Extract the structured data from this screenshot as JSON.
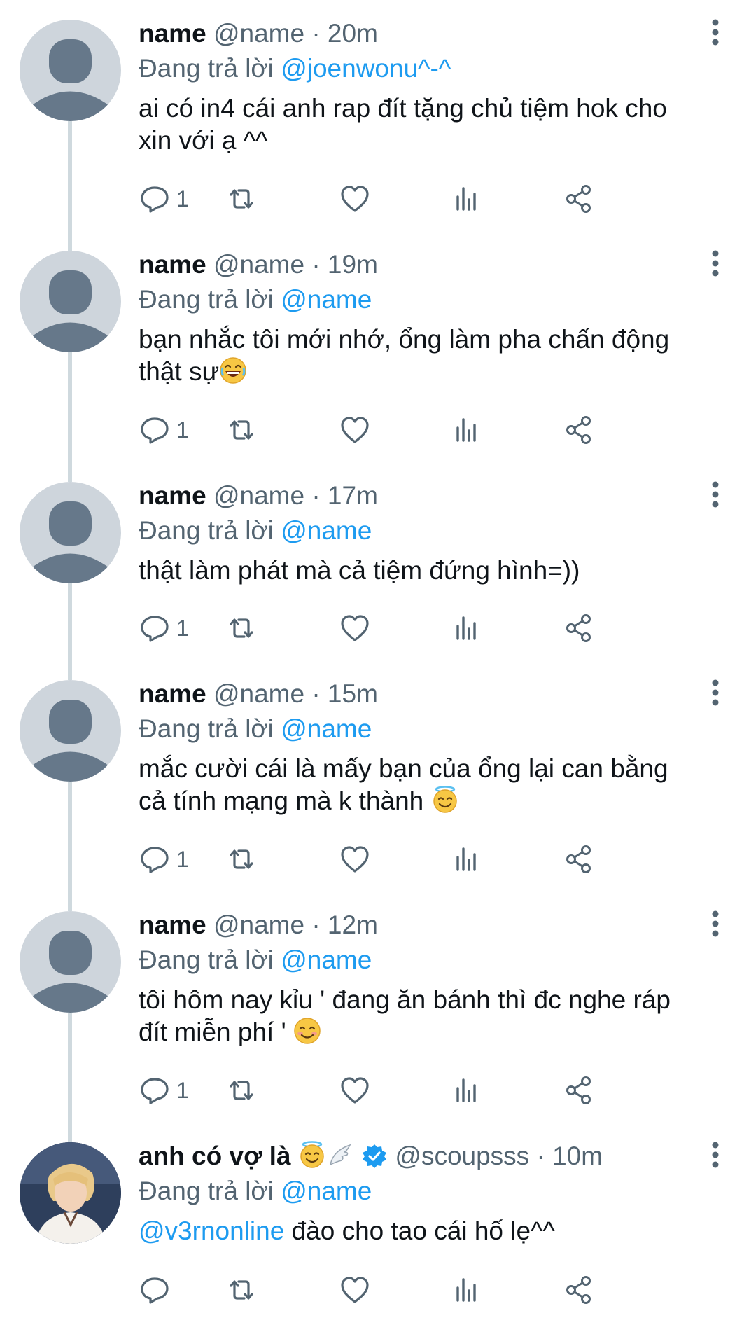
{
  "replying_label": "Đang trả lời",
  "tweets": [
    {
      "display_name": "name",
      "meta": "@name · 20m",
      "reply_to": "@joenwonu^-^",
      "text_prefix": "",
      "text": "ai có in4 cái anh rap đít tặng chủ tiệm hok cho xin với ạ ^^",
      "reply_count": "1",
      "emoji": ""
    },
    {
      "display_name": "name",
      "meta": "@name · 19m",
      "reply_to": "@name",
      "text_prefix": "",
      "text": "bạn nhắc tôi mới nhớ, ổng làm pha chấn động thật sự",
      "reply_count": "1",
      "emoji": "laughing-face"
    },
    {
      "display_name": "name",
      "meta": "@name · 17m",
      "reply_to": "@name",
      "text_prefix": "",
      "text": "thật làm phát mà cả tiệm đứng hình=))",
      "reply_count": "1",
      "emoji": ""
    },
    {
      "display_name": "name",
      "meta": "@name · 15m",
      "reply_to": "@name",
      "text_prefix": "",
      "text": "mắc cười cái là mấy bạn của ổng lại can bằng cả tính mạng mà k thành ",
      "reply_count": "1",
      "emoji": "halo-face"
    },
    {
      "display_name": "name",
      "meta": "@name · 12m",
      "reply_to": "@name",
      "text_prefix": "",
      "text": "tôi hôm nay kỉu ' đang ăn bánh thì đc nghe ráp đít miễn phí ' ",
      "reply_count": "1",
      "emoji": "smiling-face"
    },
    {
      "display_name": "anh có vợ là ",
      "meta": "@scoupsss · 10m",
      "reply_to": "@name",
      "text_prefix": "@v3rnonline",
      "text": " đào cho tao cái hố lẹ^^",
      "reply_count": "",
      "emoji": ""
    }
  ],
  "colors": {
    "text": "#0f1419",
    "secondary": "#536471",
    "accent": "#1d9bf0",
    "avatar_placeholder": "#ced5dc",
    "avatar_silhouette": "#66788a",
    "thread_line": "#cfd9de"
  },
  "icons": [
    "reply-icon",
    "retweet-icon",
    "like-icon",
    "analytics-icon",
    "share-icon",
    "more-icon",
    "verified-icon",
    "wing-icon"
  ]
}
